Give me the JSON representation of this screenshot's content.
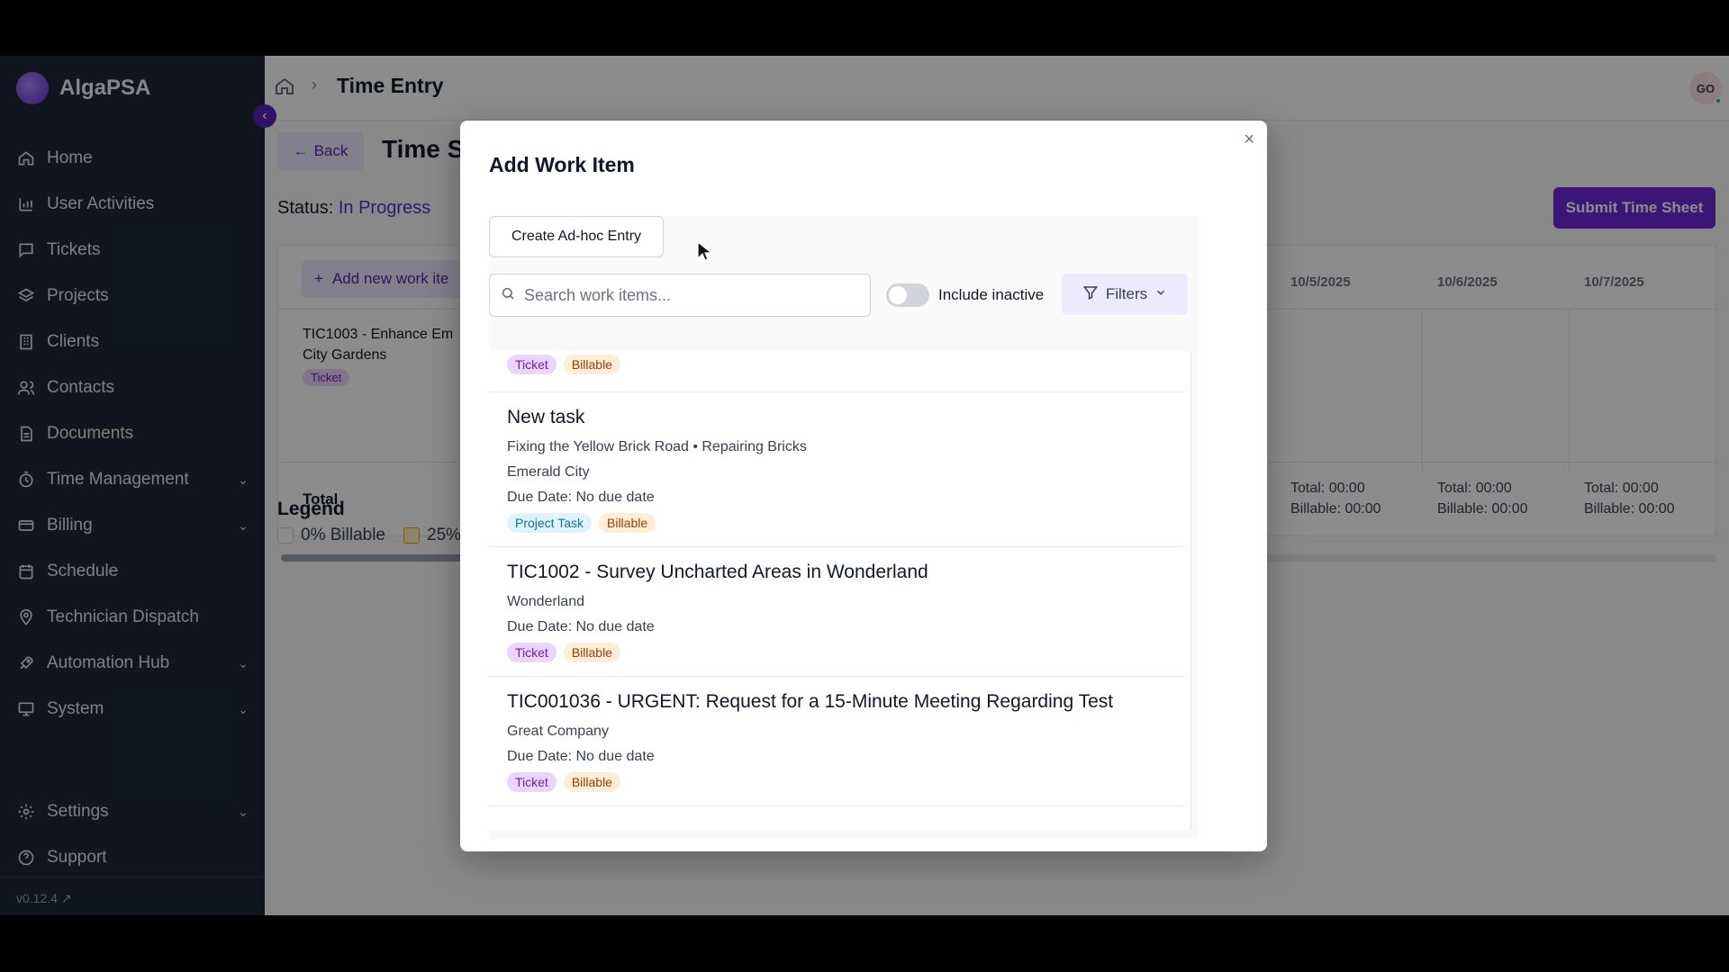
{
  "sidebar": {
    "brand": "AlgaPSA",
    "items": [
      {
        "label": "Home",
        "icon": "home-icon"
      },
      {
        "label": "User Activities",
        "icon": "chart-icon"
      },
      {
        "label": "Tickets",
        "icon": "message-icon"
      },
      {
        "label": "Projects",
        "icon": "layers-icon"
      },
      {
        "label": "Clients",
        "icon": "building-icon"
      },
      {
        "label": "Contacts",
        "icon": "users-icon"
      },
      {
        "label": "Documents",
        "icon": "document-icon"
      },
      {
        "label": "Time Management",
        "icon": "timer-icon"
      },
      {
        "label": "Billing",
        "icon": "card-icon"
      },
      {
        "label": "Schedule",
        "icon": "calendar-icon"
      },
      {
        "label": "Technician Dispatch",
        "icon": "pin-icon"
      },
      {
        "label": "Automation Hub",
        "icon": "rocket-icon"
      },
      {
        "label": "System",
        "icon": "monitor-icon"
      },
      {
        "label": "Settings",
        "icon": "gear-icon"
      },
      {
        "label": "Support",
        "icon": "help-icon"
      }
    ],
    "version": "v0.12.4"
  },
  "header": {
    "breadcrumb_title": "Time Entry",
    "avatar_initials": "GO"
  },
  "page": {
    "back_label": "Back",
    "title": "Time S",
    "status_label": "Status:",
    "status_value": "In Progress",
    "submit_label": "Submit Time Sheet",
    "add_new_label": "Add new work ite",
    "dates": [
      "10/5/2025",
      "10/6/2025",
      "10/7/2025"
    ],
    "work_item_title": "TIC1003 - Enhance Em City Gardens",
    "work_item_tag": "Ticket",
    "total_label": "Total",
    "day_totals": [
      {
        "total": "Total: 00:00",
        "billable": "Billable: 00:00"
      },
      {
        "total": "Total: 00:00",
        "billable": "Billable: 00:00"
      },
      {
        "total": "Total: 00:00",
        "billable": "Billable: 00:00"
      }
    ],
    "legend_title": "Legend",
    "legend_items": [
      "0% Billable",
      "25%"
    ]
  },
  "modal": {
    "title": "Add Work Item",
    "close": "×",
    "adhoc_label": "Create Ad-hoc Entry",
    "search_placeholder": "Search work items...",
    "include_inactive_label": "Include inactive",
    "filters_label": "Filters",
    "items": [
      {
        "title": "",
        "lines": [],
        "tags": [
          "Ticket",
          "Billable"
        ]
      },
      {
        "title": "New task",
        "lines": [
          "Fixing the Yellow Brick Road • Repairing Bricks",
          "Emerald City",
          "Due Date: No due date"
        ],
        "tags": [
          "Project Task",
          "Billable"
        ]
      },
      {
        "title": "TIC1002 - Survey Uncharted Areas in Wonderland",
        "lines": [
          "Wonderland",
          "Due Date: No due date"
        ],
        "tags": [
          "Ticket",
          "Billable"
        ]
      },
      {
        "title": "TIC001036 - URGENT: Request for a 15-Minute Meeting Regarding Test",
        "lines": [
          "Great Company",
          "Due Date: No due date"
        ],
        "tags": [
          "Ticket",
          "Billable"
        ]
      }
    ]
  },
  "colors": {
    "accent": "#6d28d9",
    "sidebar_bg": "#1f2937",
    "status_blue": "#4338ca"
  }
}
